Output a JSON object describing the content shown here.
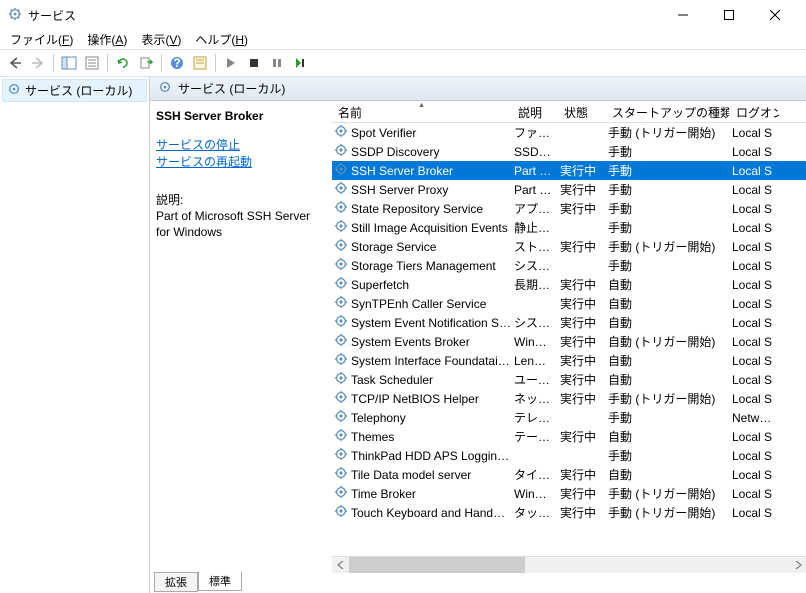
{
  "window": {
    "title": "サービス"
  },
  "menu": {
    "file": "ファイル(F)",
    "action": "操作(A)",
    "view": "表示(V)",
    "help": "ヘルプ(H)"
  },
  "left_pane": {
    "item": "サービス (ローカル)"
  },
  "header_band": {
    "title": "サービス (ローカル)"
  },
  "detail": {
    "service_name": "SSH Server Broker",
    "stop_link": "サービスの停止",
    "restart_link": "サービスの再起動",
    "desc_label": "説明:",
    "desc_text": "Part of Microsoft SSH Server for Windows"
  },
  "columns": {
    "name": "名前",
    "desc": "説明",
    "status": "状態",
    "startup": "スタートアップの種類",
    "logon": "ログオン"
  },
  "tabs": {
    "extended": "拡張",
    "standard": "標準"
  },
  "rows": [
    {
      "name": "Spot Verifier",
      "desc": "ファイ…",
      "status": "",
      "startup": "手動 (トリガー開始)",
      "logon": "Local S",
      "selected": false
    },
    {
      "name": "SSDP Discovery",
      "desc": "SSDP…",
      "status": "",
      "startup": "手動",
      "logon": "Local S",
      "selected": false
    },
    {
      "name": "SSH Server Broker",
      "desc": "Part …",
      "status": "実行中",
      "startup": "手動",
      "logon": "Local S",
      "selected": true
    },
    {
      "name": "SSH Server Proxy",
      "desc": "Part …",
      "status": "実行中",
      "startup": "手動",
      "logon": "Local S",
      "selected": false
    },
    {
      "name": "State Repository Service",
      "desc": "アプリ…",
      "status": "実行中",
      "startup": "手動",
      "logon": "Local S",
      "selected": false
    },
    {
      "name": "Still Image Acquisition Events",
      "desc": "静止…",
      "status": "",
      "startup": "手動",
      "logon": "Local S",
      "selected": false
    },
    {
      "name": "Storage Service",
      "desc": "ストレ…",
      "status": "実行中",
      "startup": "手動 (トリガー開始)",
      "logon": "Local S",
      "selected": false
    },
    {
      "name": "Storage Tiers Management",
      "desc": "システ…",
      "status": "",
      "startup": "手動",
      "logon": "Local S",
      "selected": false
    },
    {
      "name": "Superfetch",
      "desc": "長期…",
      "status": "実行中",
      "startup": "自動",
      "logon": "Local S",
      "selected": false
    },
    {
      "name": "SynTPEnh Caller Service",
      "desc": "",
      "status": "実行中",
      "startup": "自動",
      "logon": "Local S",
      "selected": false
    },
    {
      "name": "System Event Notification S…",
      "desc": "システ…",
      "status": "実行中",
      "startup": "自動",
      "logon": "Local S",
      "selected": false
    },
    {
      "name": "System Events Broker",
      "desc": "WinR…",
      "status": "実行中",
      "startup": "自動 (トリガー開始)",
      "logon": "Local S",
      "selected": false
    },
    {
      "name": "System Interface Foundatai…",
      "desc": "Leno…",
      "status": "実行中",
      "startup": "自動",
      "logon": "Local S",
      "selected": false
    },
    {
      "name": "Task Scheduler",
      "desc": "ユーザ…",
      "status": "実行中",
      "startup": "自動",
      "logon": "Local S",
      "selected": false
    },
    {
      "name": "TCP/IP NetBIOS Helper",
      "desc": "ネット…",
      "status": "実行中",
      "startup": "手動 (トリガー開始)",
      "logon": "Local S",
      "selected": false
    },
    {
      "name": "Telephony",
      "desc": "テレフ…",
      "status": "",
      "startup": "手動",
      "logon": "Network",
      "selected": false
    },
    {
      "name": "Themes",
      "desc": "テーマ…",
      "status": "実行中",
      "startup": "自動",
      "logon": "Local S",
      "selected": false
    },
    {
      "name": "ThinkPad HDD APS Loggin…",
      "desc": "",
      "status": "",
      "startup": "手動",
      "logon": "Local S",
      "selected": false
    },
    {
      "name": "Tile Data model server",
      "desc": "タイル…",
      "status": "実行中",
      "startup": "自動",
      "logon": "Local S",
      "selected": false
    },
    {
      "name": "Time Broker",
      "desc": "WinR…",
      "status": "実行中",
      "startup": "手動 (トリガー開始)",
      "logon": "Local S",
      "selected": false
    },
    {
      "name": "Touch Keyboard and Hand…",
      "desc": "タッチ…",
      "status": "実行中",
      "startup": "手動 (トリガー開始)",
      "logon": "Local S",
      "selected": false
    }
  ]
}
